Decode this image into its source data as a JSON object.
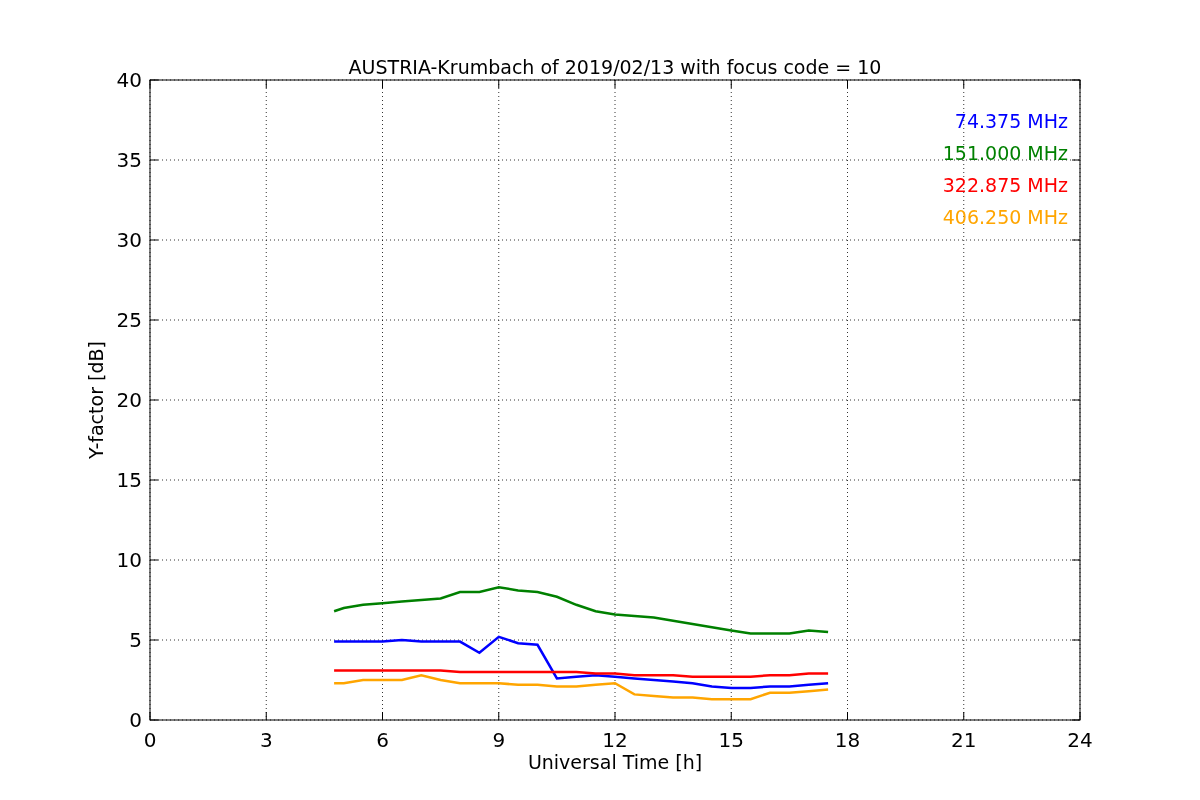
{
  "chart_data": {
    "type": "line",
    "title": "AUSTRIA-Krumbach of 2019/02/13 with focus code = 10",
    "xlabel": "Universal Time [h]",
    "ylabel": "Y-factor [dB]",
    "x": [
      4.75,
      5,
      5.5,
      6,
      6.5,
      7,
      7.5,
      8,
      8.5,
      9,
      9.5,
      10,
      10.5,
      11,
      11.5,
      12,
      12.5,
      13,
      13.5,
      14,
      14.5,
      15,
      15.5,
      16,
      16.5,
      17,
      17.5
    ],
    "series": [
      {
        "name": "74.375 MHz",
        "color": "#0000ff",
        "values": [
          4.9,
          4.9,
          4.9,
          4.9,
          5.0,
          4.9,
          4.9,
          4.9,
          4.2,
          5.2,
          4.8,
          4.7,
          2.6,
          2.7,
          2.8,
          2.7,
          2.6,
          2.5,
          2.4,
          2.3,
          2.1,
          2.0,
          2.0,
          2.1,
          2.1,
          2.2,
          2.3
        ]
      },
      {
        "name": "151.000 MHz",
        "color": "#008000",
        "values": [
          6.8,
          7.0,
          7.2,
          7.3,
          7.4,
          7.5,
          7.6,
          8.0,
          8.0,
          8.3,
          8.1,
          8.0,
          7.7,
          7.2,
          6.8,
          6.6,
          6.5,
          6.4,
          6.2,
          6.0,
          5.8,
          5.6,
          5.4,
          5.4,
          5.4,
          5.6,
          5.5
        ]
      },
      {
        "name": "322.875 MHz",
        "color": "#ff0000",
        "values": [
          3.1,
          3.1,
          3.1,
          3.1,
          3.1,
          3.1,
          3.1,
          3.0,
          3.0,
          3.0,
          3.0,
          3.0,
          3.0,
          3.0,
          2.9,
          2.9,
          2.8,
          2.8,
          2.8,
          2.7,
          2.7,
          2.7,
          2.7,
          2.8,
          2.8,
          2.9,
          2.9
        ]
      },
      {
        "name": "406.250 MHz",
        "color": "#ffa500",
        "values": [
          2.3,
          2.3,
          2.5,
          2.5,
          2.5,
          2.8,
          2.5,
          2.3,
          2.3,
          2.3,
          2.2,
          2.2,
          2.1,
          2.1,
          2.2,
          2.3,
          1.6,
          1.5,
          1.4,
          1.4,
          1.3,
          1.3,
          1.3,
          1.7,
          1.7,
          1.8,
          1.9
        ]
      }
    ],
    "xlim": [
      0,
      24
    ],
    "ylim": [
      0,
      40
    ],
    "xticks": [
      0,
      3,
      6,
      9,
      12,
      15,
      18,
      21,
      24
    ],
    "yticks": [
      0,
      5,
      10,
      15,
      20,
      25,
      30,
      35,
      40
    ],
    "grid": true
  }
}
